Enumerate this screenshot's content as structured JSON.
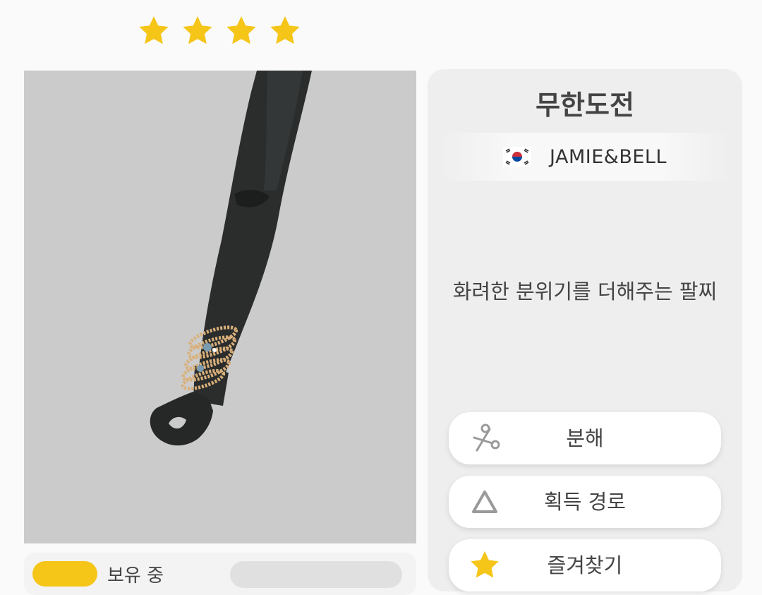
{
  "rating": {
    "stars": 4,
    "star_color": "#f5c518"
  },
  "item": {
    "title": "무한도전",
    "brand": {
      "flag": "korea-flag-icon",
      "name": "JAMIE&BELL"
    },
    "description": "화려한 분위기를 더해주는 팔찌"
  },
  "actions": [
    {
      "label": "분해",
      "icon": "scissors-icon"
    },
    {
      "label": "획득 경로",
      "icon": "triangle-icon"
    },
    {
      "label": "즐겨찾기",
      "icon": "star-icon"
    }
  ],
  "bottom_bar": {
    "label": "보유 중"
  },
  "colors": {
    "preview_bg": "#cbcbcb",
    "panel_bg": "#eeeeee",
    "accent": "#f5c518"
  }
}
